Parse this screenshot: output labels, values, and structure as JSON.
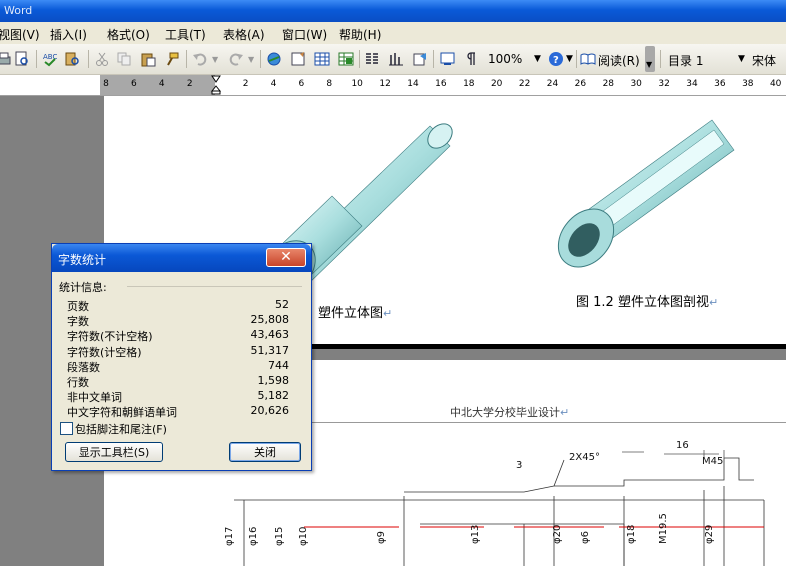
{
  "window": {
    "title": "Word"
  },
  "menu": [
    "视图(V)",
    "插入(I)",
    "格式(O)",
    "工具(T)",
    "表格(A)",
    "窗口(W)",
    "帮助(H)"
  ],
  "toolbar": {
    "zoom": "100%",
    "read_label": "阅读(R)",
    "style_value": "目录 1",
    "font_value": "宋体"
  },
  "ruler": {
    "ticks": [
      "8",
      "6",
      "4",
      "2",
      "2",
      "4",
      "6",
      "8",
      "10",
      "12",
      "14",
      "16",
      "18",
      "20",
      "22",
      "24",
      "26",
      "28",
      "30",
      "32",
      "34",
      "36",
      "38",
      "40"
    ]
  },
  "document": {
    "caption_left": "塑件立体图",
    "caption_right": "图 1.2  塑件立体图剖视",
    "page2_header": "中北大学分校毕业设计",
    "drawing_dims": [
      "16",
      "2X45°",
      "3",
      "M45",
      "φ17",
      "φ16",
      "φ15",
      "φ10",
      "φ9",
      "φ13",
      "φ20",
      "φ6",
      "φ18",
      "M19.5",
      "φ29"
    ]
  },
  "dialog": {
    "title": "字数统计",
    "group_label": "统计信息:",
    "stats": [
      {
        "label": "页数",
        "value": "52"
      },
      {
        "label": "字数",
        "value": "25,808"
      },
      {
        "label": "字符数(不计空格)",
        "value": "43,463"
      },
      {
        "label": "字符数(计空格)",
        "value": "51,317"
      },
      {
        "label": "段落数",
        "value": "744"
      },
      {
        "label": "行数",
        "value": "1,598"
      },
      {
        "label": "非中文单词",
        "value": "5,182"
      },
      {
        "label": "中文字符和朝鲜语单词",
        "value": "20,626"
      }
    ],
    "include_footnotes_label": "包括脚注和尾注(F)",
    "include_footnotes_checked": false,
    "show_toolbar_label": "显示工具栏(S)",
    "close_label": "关闭"
  }
}
